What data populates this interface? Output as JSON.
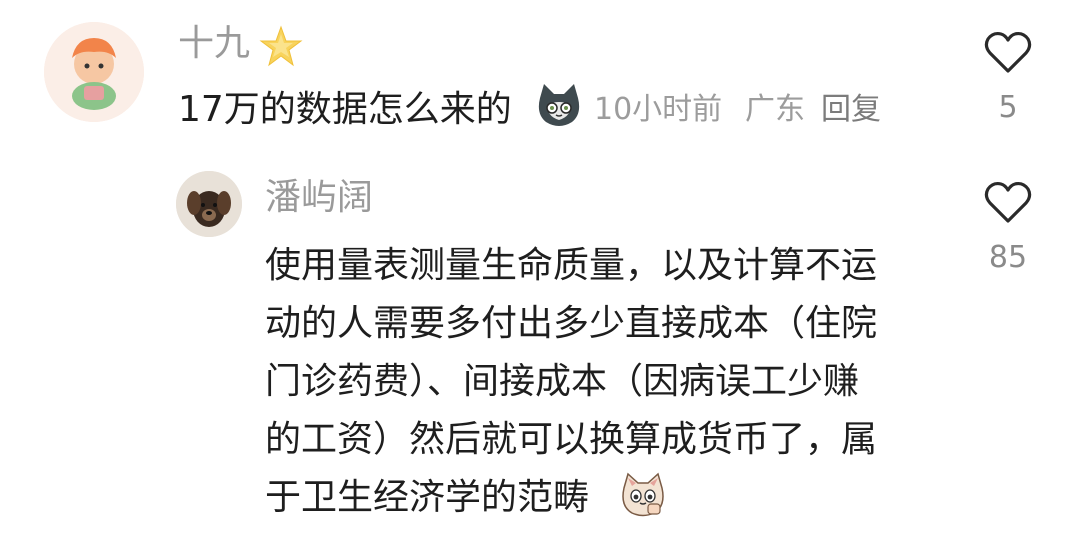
{
  "comments": [
    {
      "username": "十九",
      "text": "17万的数据怎么来的",
      "time": "10小时前",
      "location": "广东",
      "reply_label": "回复",
      "likes": "5",
      "icons": [
        "star-badge-icon",
        "cat-face-emoji",
        "heart-icon"
      ]
    },
    {
      "username": "潘屿阔",
      "lines": [
        "使用量表测量生命质量，以及计算不运",
        "动的人需要多付出多少直接成本（住院",
        "门诊药费）、间接成本（因病误工少赚",
        "的工资）然后就可以换算成货币了，属",
        "于卫生经济学的范畴"
      ],
      "likes": "85",
      "icons": [
        "cat-thumbs-up-emoji",
        "heart-icon"
      ]
    }
  ]
}
